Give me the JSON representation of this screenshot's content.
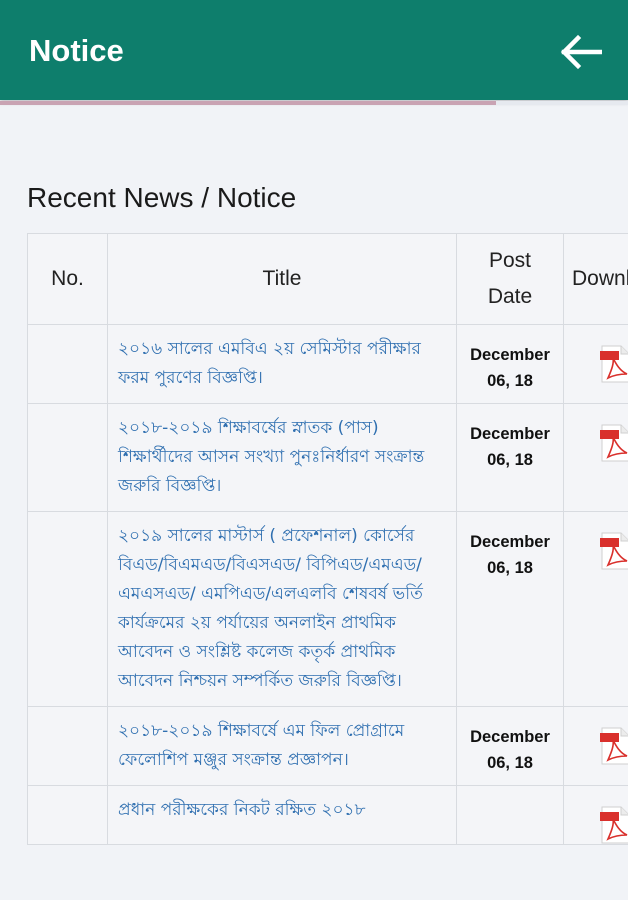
{
  "appbar": {
    "title": "Notice",
    "back_icon": "arrow-left-icon"
  },
  "progress": {
    "fraction": 0.79
  },
  "section": {
    "title": "Recent News / Notice"
  },
  "table": {
    "headers": {
      "no": "No.",
      "title": "Title",
      "post_date_1": "Post",
      "post_date_2": "Date",
      "download": "Download"
    },
    "rows": [
      {
        "no": "",
        "title": "২০১৬ সালের এমবিএ ২য় সেমিস্টার পরীক্ষার ফরম পুরণের বিজ্ঞপ্তি।",
        "date_1": "December",
        "date_2": "06, 18",
        "icon": "pdf-icon"
      },
      {
        "no": "",
        "title": "২০১৮-২০১৯ শিক্ষাবর্ষের স্নাতক (পাস) শিক্ষার্থীদের আসন সংখ্যা পুনঃনির্ধারণ সংক্রান্ত জরুরি বিজ্ঞপ্তি।",
        "date_1": "December",
        "date_2": "06, 18",
        "icon": "pdf-icon"
      },
      {
        "no": "",
        "title": "২০১৯ সালের মাস্টার্স ( প্রফেশনাল) কোর্সের বিএড/বিএমএড/বিএসএড/ বিপিএড/এমএড/এমএসএড/ এমপিএড/এলএলবি শেষবর্ষ ভর্তি কার্যক্রমের ২য় পর্যায়ের অনলাইন প্রাথমিক আবেদন ও সংশ্লিষ্ট কলেজ কতৃর্ক প্রাথমিক আবেদন নিশ্চয়ন সম্পর্কিত জরুরি বিজ্ঞপ্তি।",
        "date_1": "December",
        "date_2": "06, 18",
        "icon": "pdf-icon"
      },
      {
        "no": "",
        "title": "২০১৮-২০১৯ শিক্ষাবর্ষে এম ফিল প্রোগ্রামে ফেলোশিপ মঞ্জুর সংক্রান্ত প্রজ্ঞাপন।",
        "date_1": "December",
        "date_2": "06, 18",
        "icon": "pdf-icon"
      },
      {
        "no": "",
        "title": "প্রধান পরীক্ষকের নিকট রক্ষিত ২০১৮",
        "date_1": "",
        "date_2": "",
        "icon": "pdf-icon"
      }
    ]
  },
  "colors": {
    "appbar": "#0e7e6c",
    "link": "#2f6fb0",
    "pdf_red": "#d9302c"
  }
}
